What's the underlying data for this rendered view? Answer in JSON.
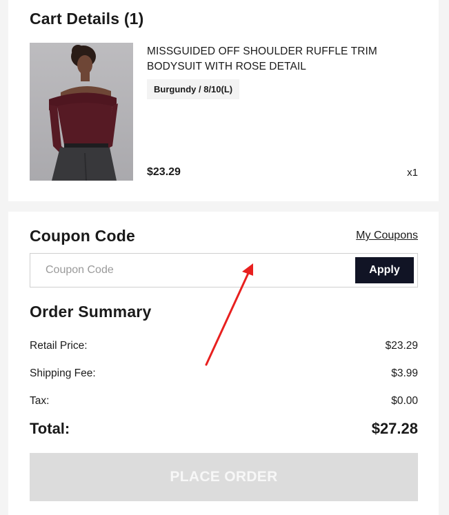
{
  "cart": {
    "title": "Cart Details (1)",
    "item": {
      "name": "MISSGUIDED OFF SHOULDER RUFFLE TRIM BODYSUIT WITH ROSE DETAIL",
      "variant": "Burgundy / 8/10(L)",
      "price": "$23.29",
      "quantity": "x1"
    }
  },
  "coupon": {
    "title": "Coupon Code",
    "my_coupons_label": "My Coupons",
    "placeholder": "Coupon Code",
    "apply_label": "Apply"
  },
  "summary": {
    "title": "Order Summary",
    "rows": [
      {
        "label": "Retail Price:",
        "value": "$23.29"
      },
      {
        "label": "Shipping Fee:",
        "value": "$3.99"
      },
      {
        "label": "Tax:",
        "value": "$0.00"
      }
    ],
    "total_label": "Total:",
    "total_value": "$27.28",
    "place_order_label": "PLACE ORDER"
  },
  "colors": {
    "apply_button": "#111425",
    "place_order_disabled": "#dcdcdc",
    "annotation_arrow": "#e8201f"
  }
}
